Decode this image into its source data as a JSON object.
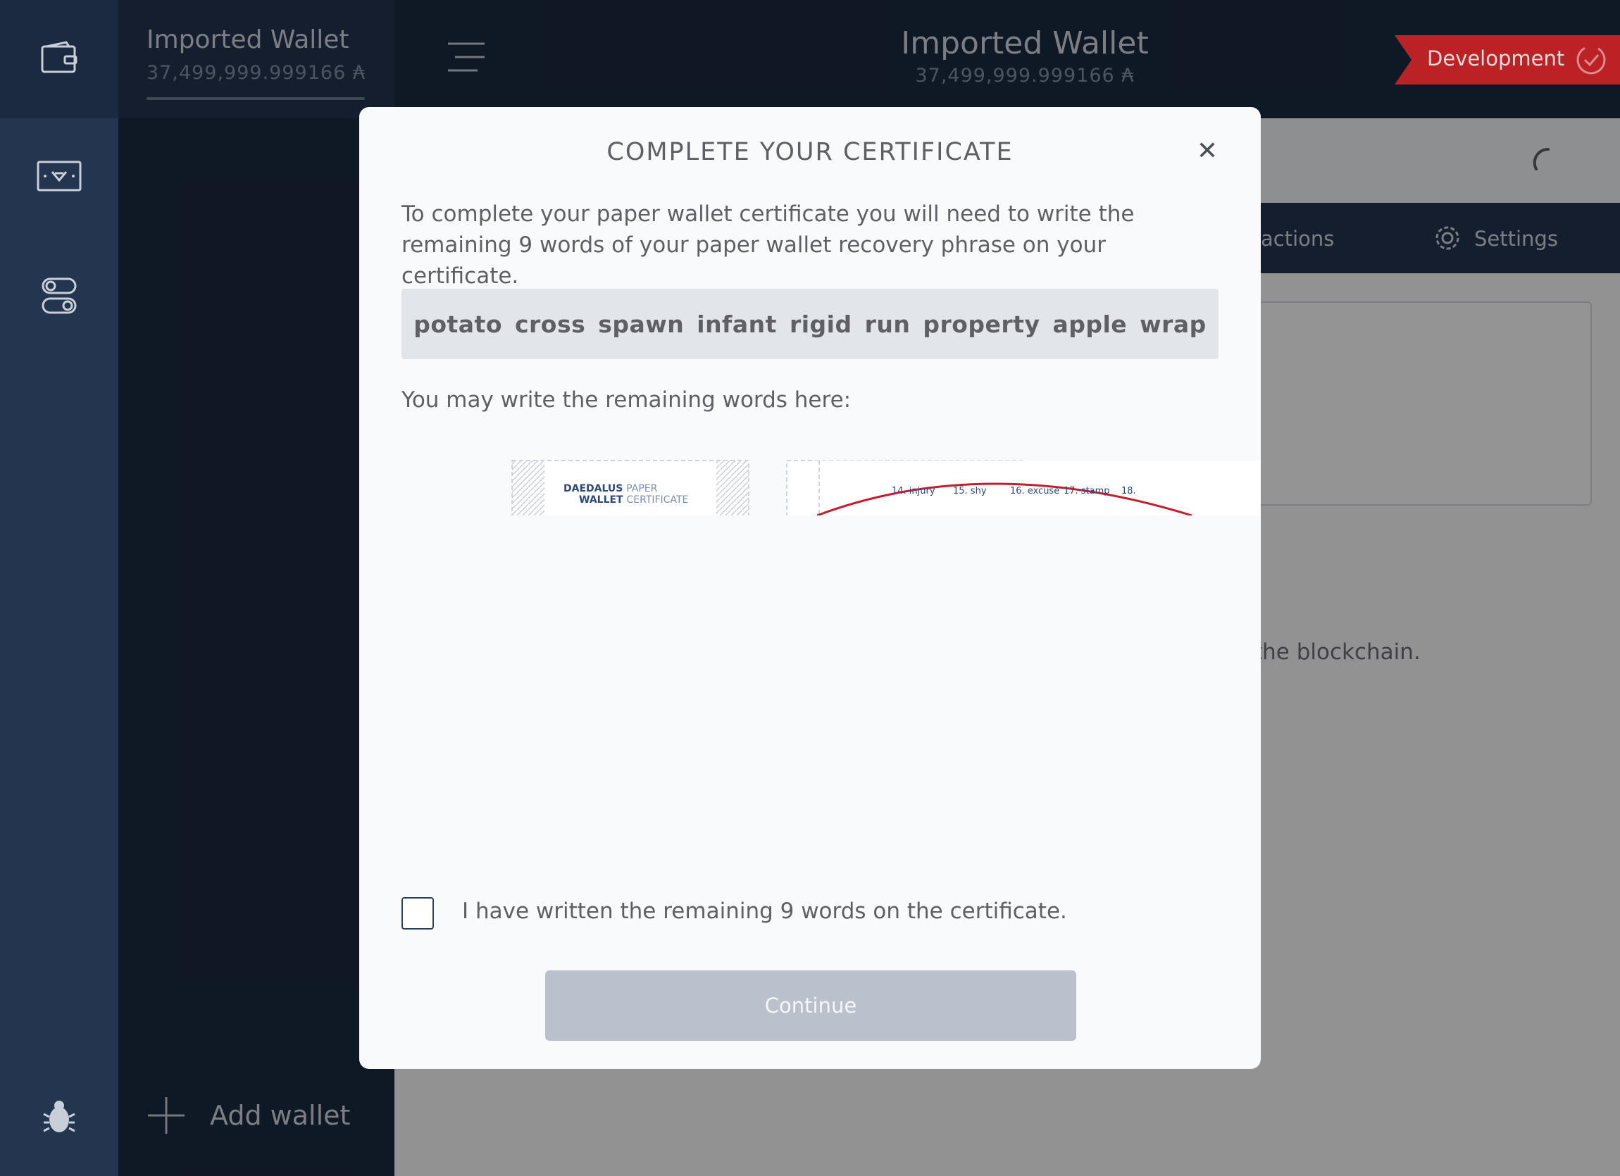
{
  "rail": {
    "icons": [
      "wallet-icon",
      "ada-redemption-icon",
      "settings-toggle-icon",
      "bug-report-icon"
    ]
  },
  "sidebar": {
    "wallet_name": "Imported Wallet",
    "wallet_balance": "37,499,999.999166 ₳",
    "add_wallet_label": "Add wallet"
  },
  "topbar": {
    "wallet_name": "Imported Wallet",
    "wallet_balance": "37,499,999.999166 ₳",
    "env_badge": "Development"
  },
  "main": {
    "nav": {
      "transactions_label": "actions",
      "settings_label": "Settings"
    },
    "empty_text": "the blockchain."
  },
  "dialog": {
    "title": "COMPLETE YOUR CERTIFICATE",
    "close_glyph": "✕",
    "instructions": "To complete your paper wallet certificate you will need to write the remaining 9 words of your paper wallet recovery phrase on your certificate.",
    "remaining_words": "potato cross spawn infant rigid run property apple wrap",
    "hint": "You may write the remaining words here:",
    "certificate": {
      "brand_line1_bold": "DAEDALUS",
      "brand_line1_light": "PAPER",
      "brand_line2_bold": "WALLET",
      "brand_line2_light": "CERTIFICATE",
      "words": [
        "14. injury",
        "15. shy",
        "16. excuse",
        "17. stamp",
        "18."
      ]
    },
    "checkbox_label": "I have written the remaining 9 words on the certificate.",
    "checkbox_checked": false,
    "continue_label": "Continue"
  },
  "colors": {
    "sidebar_dark": "#1b2a40",
    "sidebar_light": "#243550",
    "badge_red": "#bb2226",
    "button_disabled": "#bbc1cc",
    "dialog_bg": "#f9fafc"
  }
}
